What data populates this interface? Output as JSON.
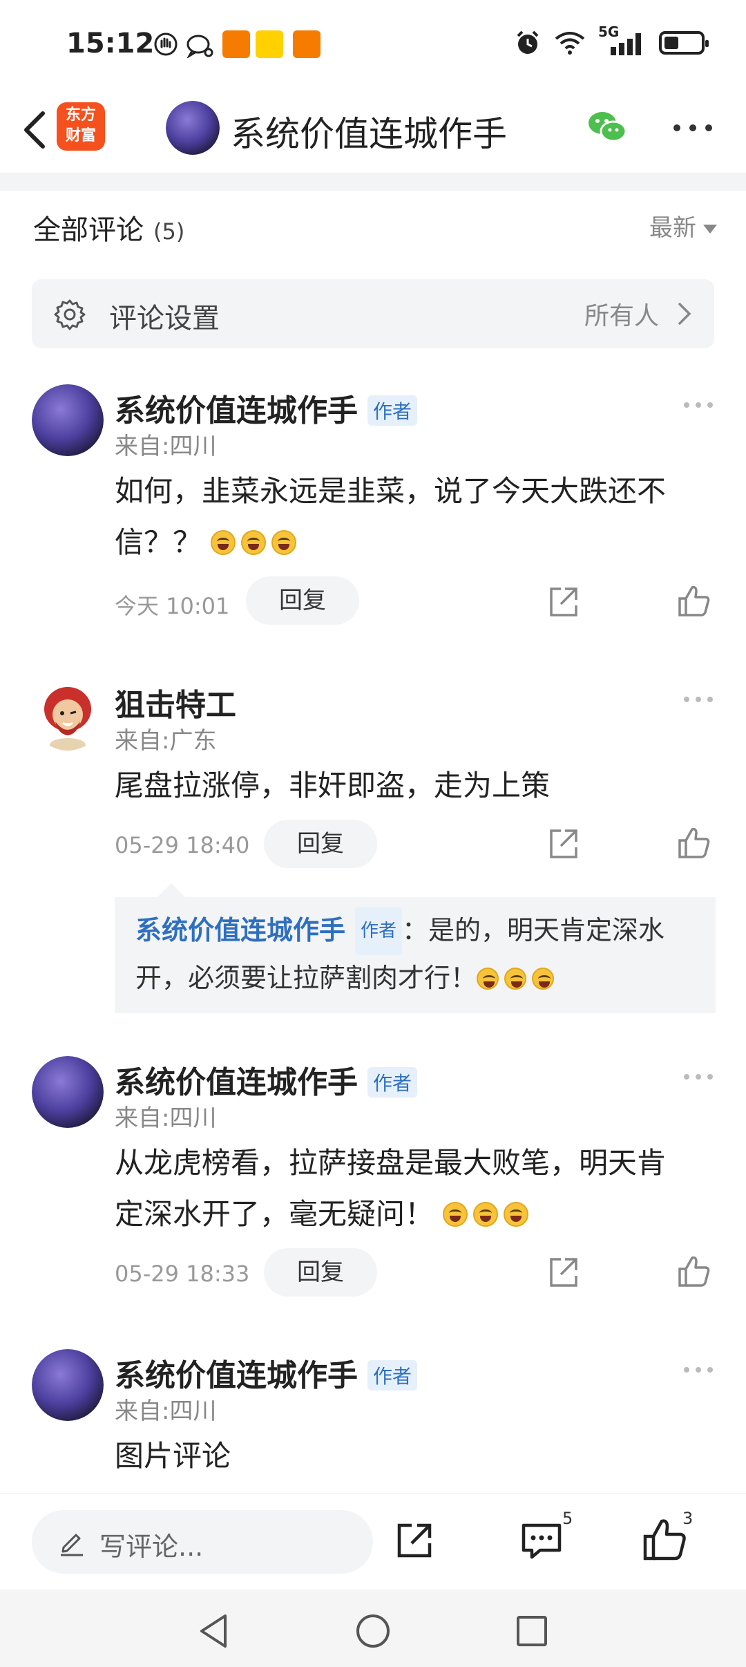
{
  "status_bar": {
    "time": "15:12",
    "network": "5G",
    "icons": [
      "hand-icon",
      "chat-bubble-icon",
      "app-notification-icon",
      "meituan-icon",
      "app-notification-icon",
      "alarm-icon",
      "wifi-icon",
      "signal-icon",
      "battery-icon"
    ]
  },
  "nav": {
    "logo_line1": "东方",
    "logo_line2": "财富",
    "title": "系统价值连城作手",
    "brand_color": "#f4511e"
  },
  "header": {
    "all_comments_label": "全部评论",
    "count": "(5)",
    "sort_label": "最新"
  },
  "settings": {
    "label": "评论设置",
    "value": "所有人"
  },
  "author_badge": "作者",
  "comments": [
    {
      "name": "系统价值连城作手",
      "is_author": true,
      "location": "来自:四川",
      "text_line1": "如何，韭菜永远是韭菜，说了今天大跌还不",
      "text_line2": "信？？",
      "emoji_count": 3,
      "time": "今天 10:01",
      "reply_label": "回复"
    },
    {
      "name": "狙击特工",
      "is_author": false,
      "location": "来自:广东",
      "text_line1": "尾盘拉涨停，非奸即盗，走为上策",
      "time": "05-29 18:40",
      "reply_label": "回复",
      "reply": {
        "name": "系统价值连城作手",
        "badge": "作者",
        "text_line1": "：是的，明天肯定深水",
        "text_line2": "开，必须要让拉萨割肉才行！",
        "emoji_count": 3
      }
    },
    {
      "name": "系统价值连城作手",
      "is_author": true,
      "location": "来自:四川",
      "text_line1": "从龙虎榜看，拉萨接盘是最大败笔，明天肯",
      "text_line2": "定深水开了，毫无疑问！",
      "emoji_count": 3,
      "time": "05-29 18:33",
      "reply_label": "回复"
    },
    {
      "name": "系统价值连城作手",
      "is_author": true,
      "location": "来自:四川",
      "text_line1": "图片评论"
    }
  ],
  "bottom_bar": {
    "write_placeholder": "写评论...",
    "comment_count": "5",
    "like_count": "3"
  }
}
